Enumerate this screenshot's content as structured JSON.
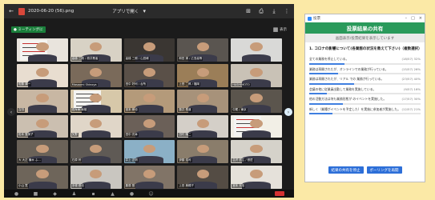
{
  "viewer": {
    "filename": "2020-06-20 (56).png",
    "open_app": "アプリで開く",
    "meeting_pill": "● ミーティングに",
    "view_label": "表示"
  },
  "tiles": [
    {
      "bg": "#e9e4dd",
      "board": true,
      "red": true,
      "name": ""
    },
    {
      "bg": "#d8d2c5",
      "name": "高橋 三朗 / 原井業者"
    },
    {
      "bg": "#3a3632",
      "name": "高橋 三朗 / 山田様"
    },
    {
      "bg": "#5a5550",
      "name": "和田 清 / 広島高等"
    },
    {
      "bg": "#d9d9d7",
      "name": ""
    },
    {
      "bg": "#e8ddd0",
      "name": "佐藤 清一"
    },
    {
      "bg": "#7a6a5a",
      "name": "Masaomi Shinoya"
    },
    {
      "bg": "#5a5048",
      "name": "田中 好司 / 台所"
    },
    {
      "bg": "#9b7e58",
      "name": "上田 二郎 / 福岡"
    },
    {
      "bg": "#c9c2b6",
      "name": "HASHIMOTO"
    },
    {
      "bg": "#c8b7a3",
      "name": "吉田"
    },
    {
      "bg": "#d7c8a9",
      "board": true,
      "name": "佐々木 幸雄"
    },
    {
      "bg": "#b49a7a",
      "name": "宮本 伸也"
    },
    {
      "bg": "#a7927a",
      "name": "藤井 長道"
    },
    {
      "bg": "#5b554d",
      "name": "中尾 / 東京"
    },
    {
      "bg": "#cbbfb0",
      "name": "松本 登美子"
    },
    {
      "bg": "#e0d6c8",
      "name": "矢野"
    },
    {
      "bg": "#6b6058",
      "name": "田中 光幸"
    },
    {
      "bg": "#d4cfc8",
      "name": "田村 隆二"
    },
    {
      "bg": "#f2efe6",
      "board": true,
      "red": true,
      "name": ""
    },
    {
      "bg": "#6a6258",
      "name": "大 大正 横木 ふ..."
    },
    {
      "bg": "#5f5a55",
      "name": "石原 鈴"
    },
    {
      "bg": "#8bb0c6",
      "name": "井上 正明"
    },
    {
      "bg": "#8a7d6b",
      "name": "伊藤 浩司"
    },
    {
      "bg": "#d5d2ca",
      "name": "吉沢 信広 / 鉄匠"
    },
    {
      "bg": "#6e655a",
      "name": "小山 寛"
    },
    {
      "bg": "#c9c6c0",
      "name": "手塚 鉄也"
    },
    {
      "bg": "#817467",
      "name": "藤原 登"
    },
    {
      "bg": "#544c44",
      "name": "上田 美穂子"
    },
    {
      "bg": "#e5e1da",
      "name": "宮本 光信"
    }
  ],
  "poll": {
    "window_title": "投票",
    "header": "投票結果の共有",
    "subheader": "画面表示/投票結果を表示しています",
    "question": "1. コロナの影響について(各業態の状況を教えて下さい)（複数選択）",
    "options": [
      {
        "label": "全ての業務を停止している。",
        "pct": "(18/57) 32%",
        "fill": 0.32
      },
      {
        "label": "業務は再開されたが、オンラインでの業務が行っている。",
        "pct": "(15/57) 26%",
        "fill": 0.26
      },
      {
        "label": "業務は再開されたが、リアル での 業務が行っている。",
        "pct": "(23/57) 40%",
        "fill": 0.4
      },
      {
        "label": "会議の他に従業員出勤して業務を実施している。",
        "pct": "(9/57) 16%",
        "fill": 0.16
      },
      {
        "label": "他の活動方法は何も業務形態が のイベントを実施した。",
        "pct": "(17/57) 30%",
        "fill": 0.3
      },
      {
        "label": "新しく（業種がイベントを予定した）を実施に参加者が実施した。",
        "pct": "(12/57) 21%",
        "fill": 0.21
      }
    ],
    "stop_share": "結果の共有を停止",
    "repoll": "ポーリングを再開"
  }
}
